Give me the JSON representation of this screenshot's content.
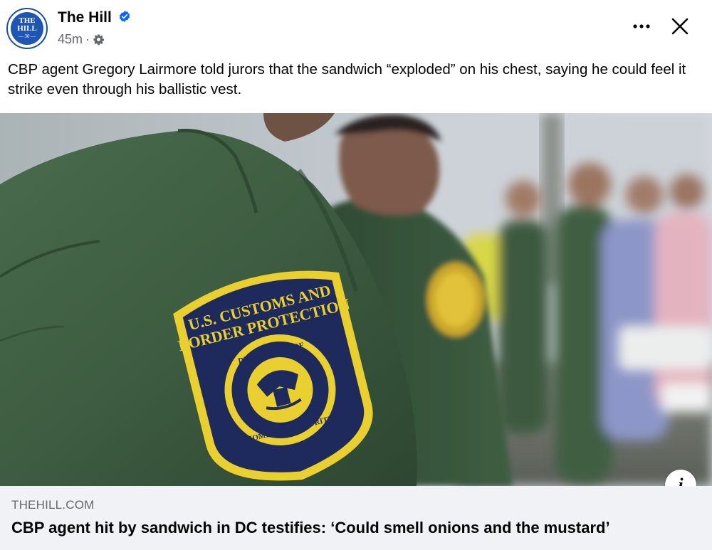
{
  "post": {
    "page_name": "The Hill",
    "timestamp": "45m",
    "separator": "·",
    "audience_icon": "gear-icon",
    "message": "CBP agent Gregory Lairmore told jurors that the sandwich “exploded” on his chest, saying he could feel it strike even through his ballistic vest.",
    "avatar": {
      "line1": "THE",
      "line2": "HILL",
      "line3": "— 30 —"
    }
  },
  "photo": {
    "patch_line1": "U.S. CUSTOMS AND",
    "patch_line2": "BORDER PROTECTION",
    "seal_top": "DEPARTMENT OF",
    "seal_left": "U.S.",
    "seal_bottom": "HOMELAND SECURITY"
  },
  "link_preview": {
    "domain": "THEHILL.COM",
    "title": "CBP agent hit by sandwich in DC testifies: ‘Could smell onions and the mustard’",
    "info_glyph": "i"
  },
  "colors": {
    "verified_blue": "#0866ff",
    "secondary_text": "#65676b",
    "footer_bg": "#f0f2f5",
    "patch_navy": "#1f2a5c",
    "patch_gold": "#e9cf2f",
    "uniform_green": "#3f5f43"
  }
}
